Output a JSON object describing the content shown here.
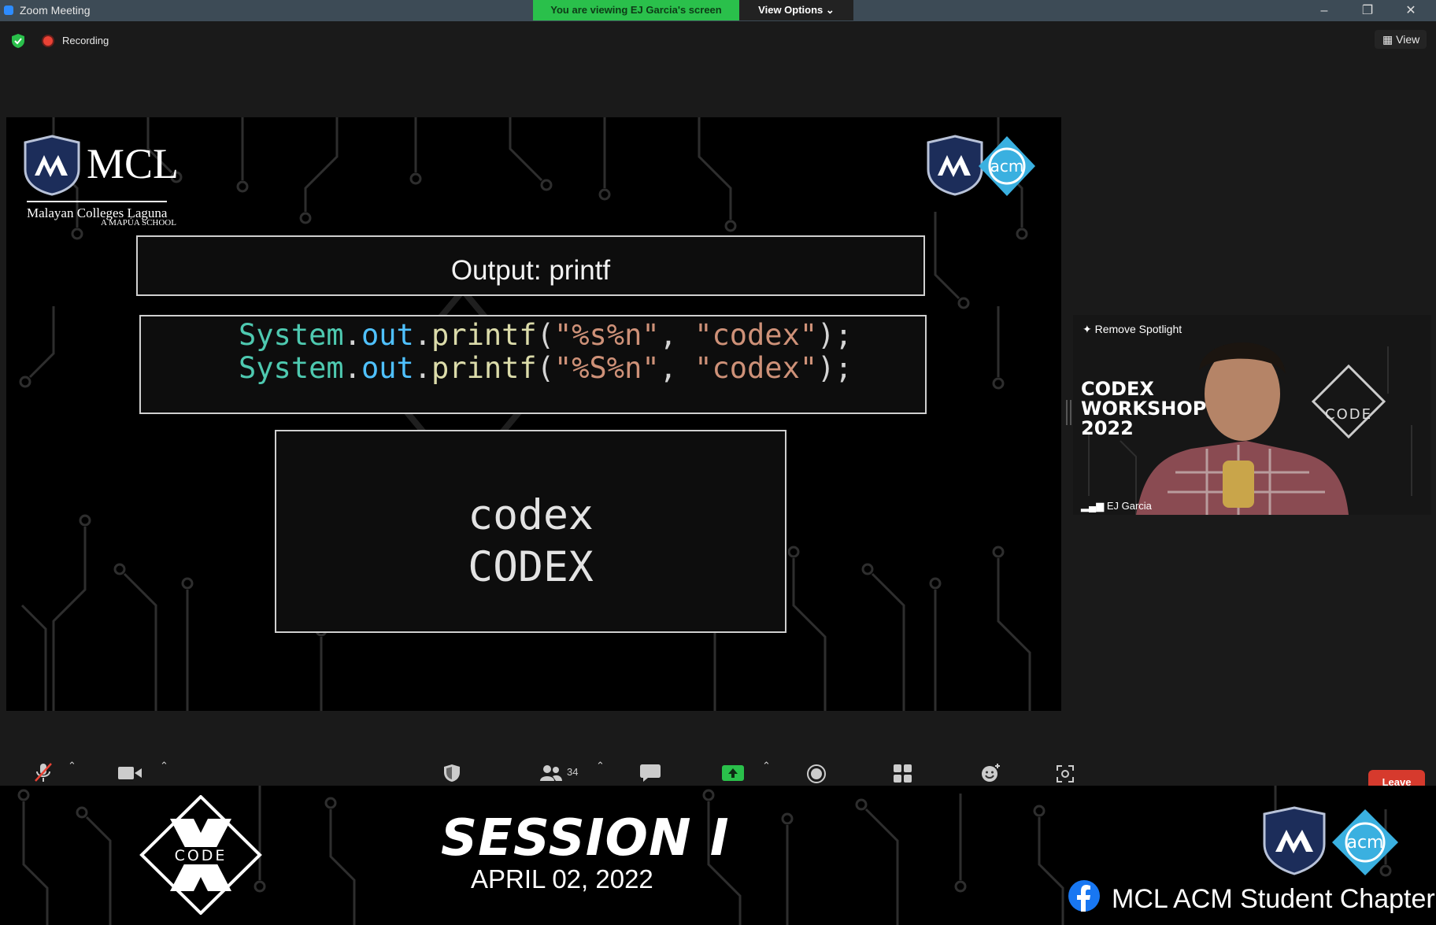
{
  "window": {
    "title": "Zoom Meeting",
    "viewing_banner": "You are viewing EJ Garcia's screen",
    "view_options": "View Options",
    "minimize": "–",
    "restore": "❐",
    "close": "✕"
  },
  "status": {
    "recording_label": "Recording",
    "view_label": "View"
  },
  "slide": {
    "logo_text": "MCL",
    "logo_subtitle": "Malayan Colleges Laguna",
    "logo_tagline": "A MAPÚA SCHOOL",
    "acm_text": "acm",
    "title": "Output: printf",
    "code": [
      {
        "cls": "System",
        "dot1": ".",
        "fld": "out",
        "dot2": ".",
        "mth": "printf",
        "open": "(",
        "fmt": "\"%s%n\"",
        "comma": ", ",
        "arg": "\"codex\"",
        "close": ");"
      },
      {
        "cls": "System",
        "dot1": ".",
        "fld": "out",
        "dot2": ".",
        "mth": "printf",
        "open": "(",
        "fmt": "\"%S%n\"",
        "comma": ", ",
        "arg": "\"codex\"",
        "close": ");"
      }
    ],
    "output": [
      "codex",
      "CODEX"
    ]
  },
  "speaker": {
    "spotlight_label": "Remove Spotlight",
    "workshop_lines": [
      "CODEX",
      "WORKSHOP",
      "2022"
    ],
    "code_badge": "CODE",
    "name": "EJ Garcia"
  },
  "toolbar": {
    "participants_count": "34",
    "leave_label": "Leave"
  },
  "banner": {
    "session_title": "SESSION I",
    "session_date": "APRIL 02, 2022",
    "code_badge": "CODE",
    "acm_text": "acm",
    "facebook_label": "MCL ACM Student Chapter"
  },
  "colors": {
    "zoom_green": "#2ac04b",
    "leave_red": "#d63a2d",
    "acm_blue": "#3ab0e0",
    "mcl_navy": "#1c2d5a"
  }
}
